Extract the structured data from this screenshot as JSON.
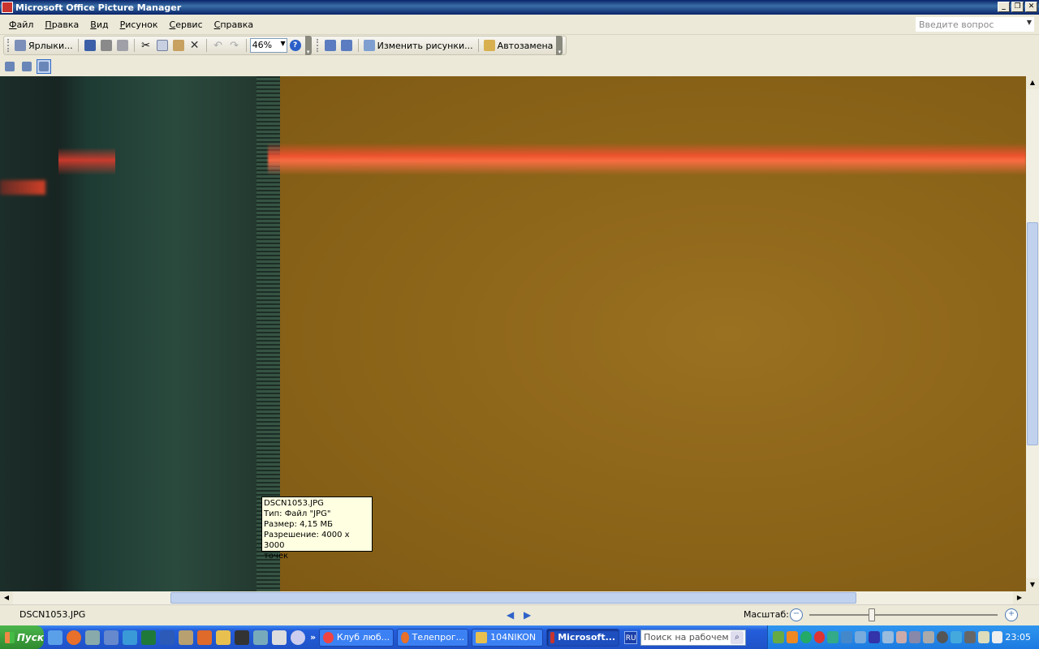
{
  "window": {
    "title": "Microsoft Office Picture Manager",
    "controls": [
      "_",
      "❐",
      "✕"
    ]
  },
  "menu": [
    "Файл",
    "Правка",
    "Вид",
    "Рисунок",
    "Сервис",
    "Справка"
  ],
  "ask_box": {
    "placeholder": "Введите вопрос"
  },
  "toolbar": {
    "shortcuts_label": "Ярлыки...",
    "zoom_value": "46%",
    "edit_pictures_label": "Изменить рисунки...",
    "autocorrect_label": "Автозамена"
  },
  "tooltip": {
    "line1": "DSCN1053.JPG",
    "line2": "Тип: Файл \"JPG\"",
    "line3": "Размер: 4,15 МБ",
    "line4": "Разрешение: 4000 x 3000",
    "line5": "точек"
  },
  "status": {
    "filename": "DSCN1053.JPG",
    "zoom_label": "Масштаб:"
  },
  "taskbar": {
    "start_label": "Пуск",
    "tasks": [
      {
        "label": "Клуб люб..."
      },
      {
        "label": "Телепрог..."
      },
      {
        "label": "104NIKON"
      },
      {
        "label": "Microsoft..."
      }
    ],
    "lang": "RU",
    "search_placeholder": "Поиск на рабочем ст",
    "clock": "23:05"
  }
}
